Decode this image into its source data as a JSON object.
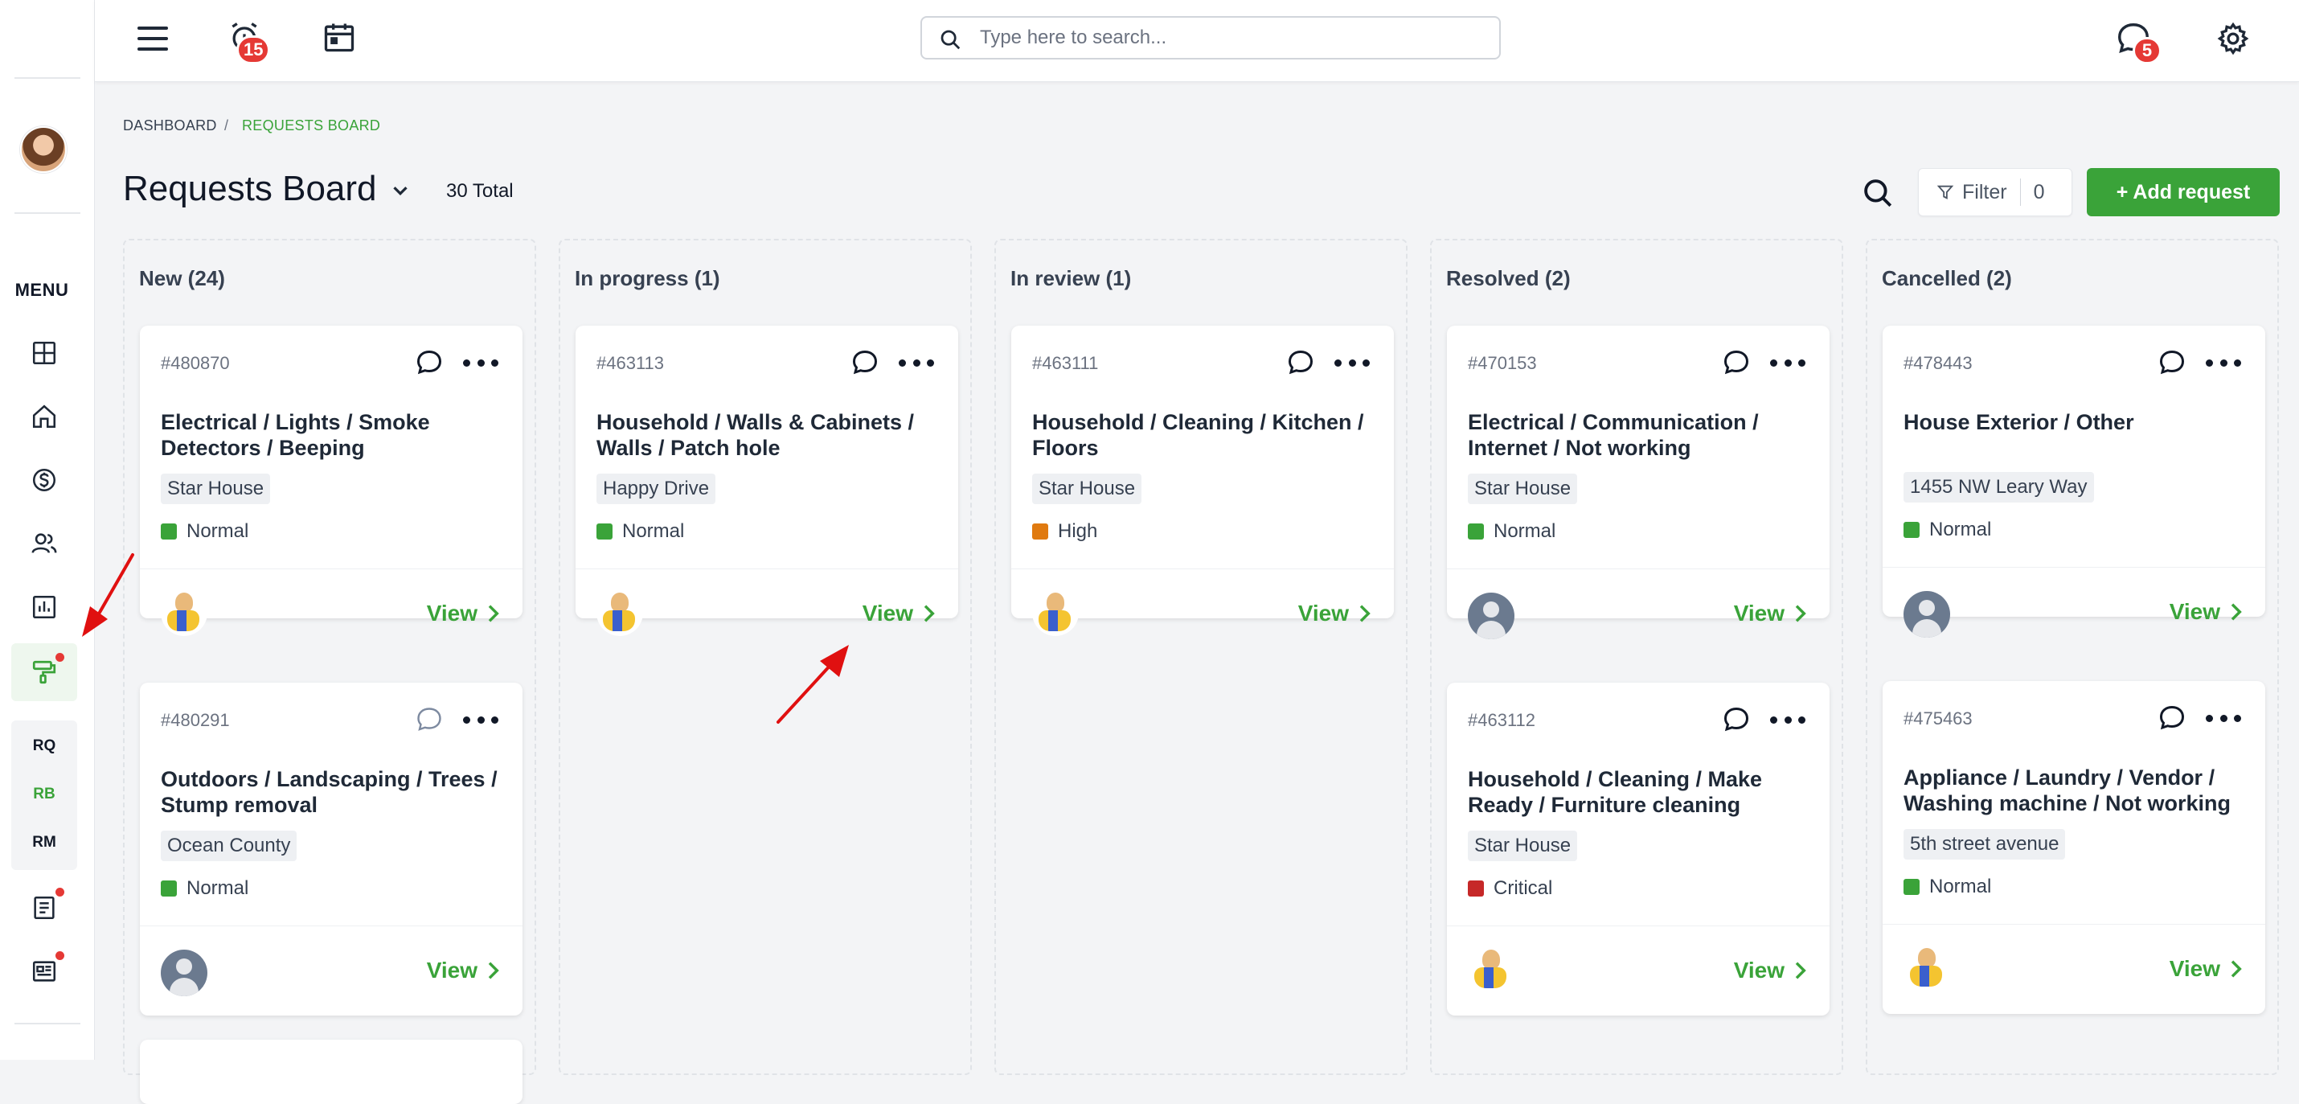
{
  "topbar": {
    "notifications_count": "15",
    "messages_count": "5",
    "search_placeholder": "Type here to search..."
  },
  "sidebar": {
    "menu_label": "MENU",
    "sub_items": [
      "RQ",
      "RB",
      "RM"
    ]
  },
  "breadcrumb": {
    "root": "DASHBOARD",
    "separator": "/",
    "current": "REQUESTS BOARD"
  },
  "header": {
    "title": "Requests Board",
    "total": "30 Total",
    "filter_label": "Filter",
    "filter_count": "0",
    "add_label": "+ Add request"
  },
  "columns": [
    {
      "title": "New (24)",
      "cards": [
        {
          "id": "#480870",
          "title": "Electrical / Lights / Smoke Detectors / Beeping",
          "location": "Star House",
          "priority": "Normal",
          "avatar": "cleaner",
          "view": "View"
        },
        {
          "id": "#480291",
          "title": "Outdoors / Landscaping / Trees / Stump removal",
          "location": "Ocean County",
          "priority": "Normal",
          "avatar": "user",
          "view": "View"
        }
      ]
    },
    {
      "title": "In progress (1)",
      "cards": [
        {
          "id": "#463113",
          "title": "Household / Walls & Cabinets / Walls / Patch hole",
          "location": "Happy Drive",
          "priority": "Normal",
          "avatar": "cleaner",
          "view": "View"
        }
      ]
    },
    {
      "title": "In review (1)",
      "cards": [
        {
          "id": "#463111",
          "title": "Household / Cleaning / Kitchen / Floors",
          "location": "Star House",
          "priority": "High",
          "avatar": "cleaner",
          "view": "View"
        }
      ]
    },
    {
      "title": "Resolved (2)",
      "cards": [
        {
          "id": "#470153",
          "title": "Electrical / Communication / Internet / Not working",
          "location": "Star House",
          "priority": "Normal",
          "avatar": "user",
          "view": "View"
        },
        {
          "id": "#463112",
          "title": "Household / Cleaning / Make Ready / Furniture cleaning",
          "location": "Star House",
          "priority": "Critical",
          "avatar": "cleaner",
          "view": "View"
        }
      ]
    },
    {
      "title": "Cancelled (2)",
      "cards": [
        {
          "id": "#478443",
          "title": "House Exterior / Other",
          "location": "1455 NW Leary Way",
          "priority": "Normal",
          "avatar": "user",
          "view": "View"
        },
        {
          "id": "#475463",
          "title": "Appliance / Laundry / Vendor / Washing machine / Not working",
          "location": "5th street avenue",
          "priority": "Normal",
          "avatar": "cleaner",
          "view": "View"
        }
      ]
    }
  ],
  "colors": {
    "accent_green": "#3aa339",
    "priority_normal": "#3aa339",
    "priority_high": "#e07a10",
    "priority_critical": "#c62828",
    "badge_red": "#e53935",
    "annotation_arrow": "#e01010"
  }
}
